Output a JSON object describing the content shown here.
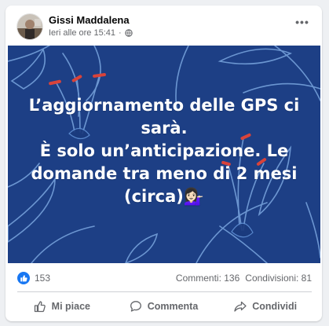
{
  "post": {
    "author": "Gissi Maddalena",
    "timestamp": "Ieri alle ore 15:41",
    "separator": "·",
    "audience_icon": "globe-icon",
    "more_icon": "more-horizontal-icon",
    "more_label": "•••"
  },
  "image": {
    "headline_lines": [
      "L’aggiornamento delle GPS ci",
      "sarà.",
      "È solo un’anticipazione. Le",
      "domande tra meno di 2 mesi",
      "(circa)💁🏻‍♀️"
    ],
    "colors": {
      "background": "#1d3f85",
      "leaf_stroke": "#7aa6df",
      "accent": "#d9433a"
    }
  },
  "stats": {
    "reaction_icon": "like-reaction-icon",
    "reactions_count": "153",
    "comments": "Commenti: 136",
    "shares": "Condivisioni: 81"
  },
  "actions": {
    "like_label": "Mi piace",
    "comment_label": "Commenta",
    "share_label": "Condividi"
  },
  "colors": {
    "brand": "#1877f2",
    "secondary_text": "#65676b"
  }
}
